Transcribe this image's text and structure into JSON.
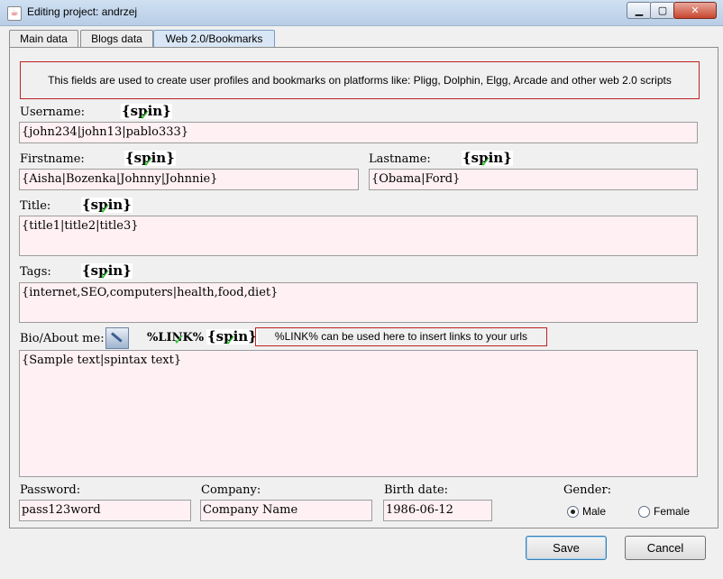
{
  "window": {
    "title": "Editing project: andrzej",
    "min": "▁",
    "max": "▢",
    "close": "✕",
    "app_icon": "java-cup-icon"
  },
  "tabs": [
    "Main data",
    "Blogs data",
    "Web 2.0/Bookmarks"
  ],
  "active_tab": "Web 2.0/Bookmarks",
  "info": "This fields are used to create user profiles and bookmarks on platforms like: Pligg, Dolphin, Elgg, Arcade and other web 2.0 scripts",
  "spin": "{spin}",
  "link_tag": "%LINK%",
  "link_note": "%LINK% can be used here to insert links to your urls",
  "fields": {
    "username": {
      "label": "Username:",
      "value": "{john234|john13|pablo333}"
    },
    "firstname": {
      "label": "Firstname:",
      "value": "{Aisha|Bozenka|Johnny|Johnnie}"
    },
    "lastname": {
      "label": "Lastname:",
      "value": "{Obama|Ford}"
    },
    "title": {
      "label": "Title:",
      "value": "{title1|title2|title3}"
    },
    "tags": {
      "label": "Tags:",
      "value": "{internet,SEO,computers|health,food,diet}"
    },
    "bio": {
      "label": "Bio/About me:",
      "value": "{Sample text|spintax text}"
    },
    "password": {
      "label": "Password:",
      "value": "pass123word"
    },
    "company": {
      "label": "Company:",
      "value": "Company Name"
    },
    "birth_date": {
      "label": "Birth date:",
      "value": "1986-06-12"
    },
    "gender": {
      "label": "Gender:",
      "options": [
        "Male",
        "Female"
      ],
      "selected": "Male"
    }
  },
  "buttons": {
    "save": "Save",
    "cancel": "Cancel"
  },
  "colors": {
    "field_bg": "#fff0f3",
    "border_red": "#c02020",
    "check_green": "#2fbf2f"
  }
}
